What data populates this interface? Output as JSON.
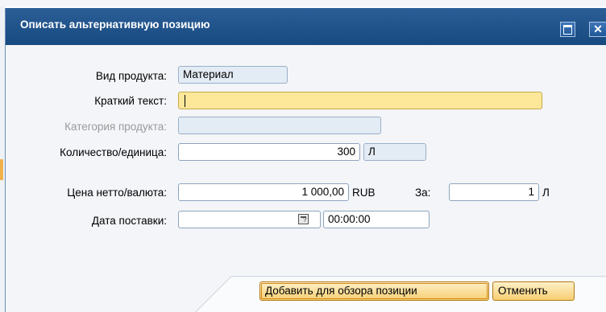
{
  "window": {
    "title": "Описать альтернативную позицию"
  },
  "form": {
    "product_type": {
      "label": "Вид продукта:",
      "value": "Материал"
    },
    "short_text": {
      "label": "Краткий текст:",
      "value": ""
    },
    "product_category": {
      "label": "Категория продукта:",
      "value": ""
    },
    "quantity_unit": {
      "label": "Количество/единица:",
      "quantity": "300",
      "unit": "Л"
    },
    "net_price_currency": {
      "label": "Цена нетто/валюта:",
      "price": "1 000,00",
      "currency": "RUB",
      "per_label": "За:",
      "per_value": "1",
      "per_unit": "Л"
    },
    "delivery_date": {
      "label": "Дата поставки:",
      "date": "",
      "time": "00:00:00"
    }
  },
  "buttons": {
    "add_label": "Добавить для обзора позиции",
    "cancel_label": "Отменить"
  },
  "colors": {
    "titlebar": "#1f5490",
    "focused_input": "#fde89a",
    "readonly_input": "#e3ebf4",
    "button": "#f6cf72"
  }
}
